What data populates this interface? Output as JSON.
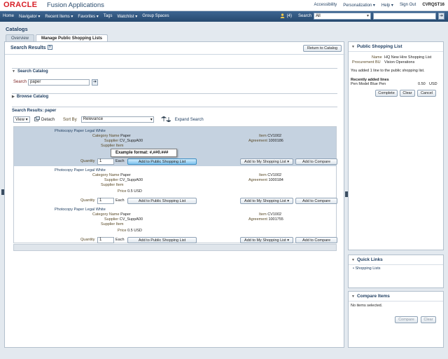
{
  "brand": {
    "oracle": "ORACLE",
    "product": "Fusion Applications"
  },
  "toplinks": {
    "accessibility": "Accessibility",
    "personalization": "Personalization ▾",
    "help": "Help ▾",
    "signout": "Sign Out",
    "user": "CVRQST16"
  },
  "nav": {
    "items": [
      "Home",
      "Navigator ▾",
      "Recent Items ▾",
      "Favorites ▾",
      "Tags",
      "Watchlist ▾",
      "Group Spaces"
    ],
    "notification": "(4)",
    "search_label": "Search",
    "search_scope": "All"
  },
  "page": {
    "title": "Catalogs"
  },
  "tabs": [
    {
      "label": "Overview"
    },
    {
      "label": "Manage Public Shopping Lists"
    }
  ],
  "main": {
    "header": "Search Results",
    "return_button": "Return to Catalog",
    "search_catalog": {
      "title": "Search Catalog",
      "label": "Search",
      "value": "paper"
    },
    "browse_catalog": {
      "title": "Browse Catalog"
    },
    "results_title": "Search Results: paper",
    "toolbar": {
      "view": "View ▾",
      "detach": "Detach",
      "sortby_label": "Sort By",
      "sortby_value": "Relevance",
      "expand": "Expand Search"
    },
    "labels": {
      "category": "Category Name",
      "supplier": "Supplier",
      "supplier_item": "Supplier Item",
      "price": "Price",
      "item": "Item",
      "agreement": "Agreement",
      "quantity": "Quantity",
      "uom": "Each"
    },
    "buttons": {
      "public": "Add to Public Shopping List",
      "my": "Add to My Shopping List",
      "compare": "Add to Compare"
    },
    "rows": [
      {
        "name": "Photocopy Paper Legal White",
        "category": "Paper",
        "supplier": "CV_SuppA00",
        "price": "",
        "item": "CV1002",
        "agreement": "1000186",
        "qty": "1"
      },
      {
        "name": "Photocopy Paper Legal White",
        "category": "Paper",
        "supplier": "CV_SuppA00",
        "price": "0.5 USD",
        "item": "CV1002",
        "agreement": "1000184",
        "qty": "1"
      },
      {
        "name": "Photocopy Paper Legal White",
        "category": "Paper",
        "supplier": "CV_SuppA00",
        "price": "0.5 USD",
        "item": "CV1002",
        "agreement": "1001755",
        "qty": "1"
      }
    ],
    "tooltip": "Example format: #,##0.###"
  },
  "public_list": {
    "title": "Public Shopping List",
    "name_label": "Name",
    "name_value": "HQ New Hire Shopping List",
    "bu_label": "Procurement BU",
    "bu_value": "Vision Operations",
    "message": "You added 1 line to the public shopping list.",
    "recent_title": "Recently added lines",
    "recent_item": "Pen Model Blue Pen",
    "recent_price": "0.50",
    "recent_currency": "USD",
    "buttons": {
      "complete": "Complete",
      "clear": "Clear",
      "cancel": "Cancel"
    }
  },
  "quick_links": {
    "title": "Quick Links",
    "item": "Shopping Lists"
  },
  "compare": {
    "title": "Compare Items",
    "empty": "No items selected.",
    "compare_btn": "Compare",
    "clear_btn": "Clear"
  }
}
